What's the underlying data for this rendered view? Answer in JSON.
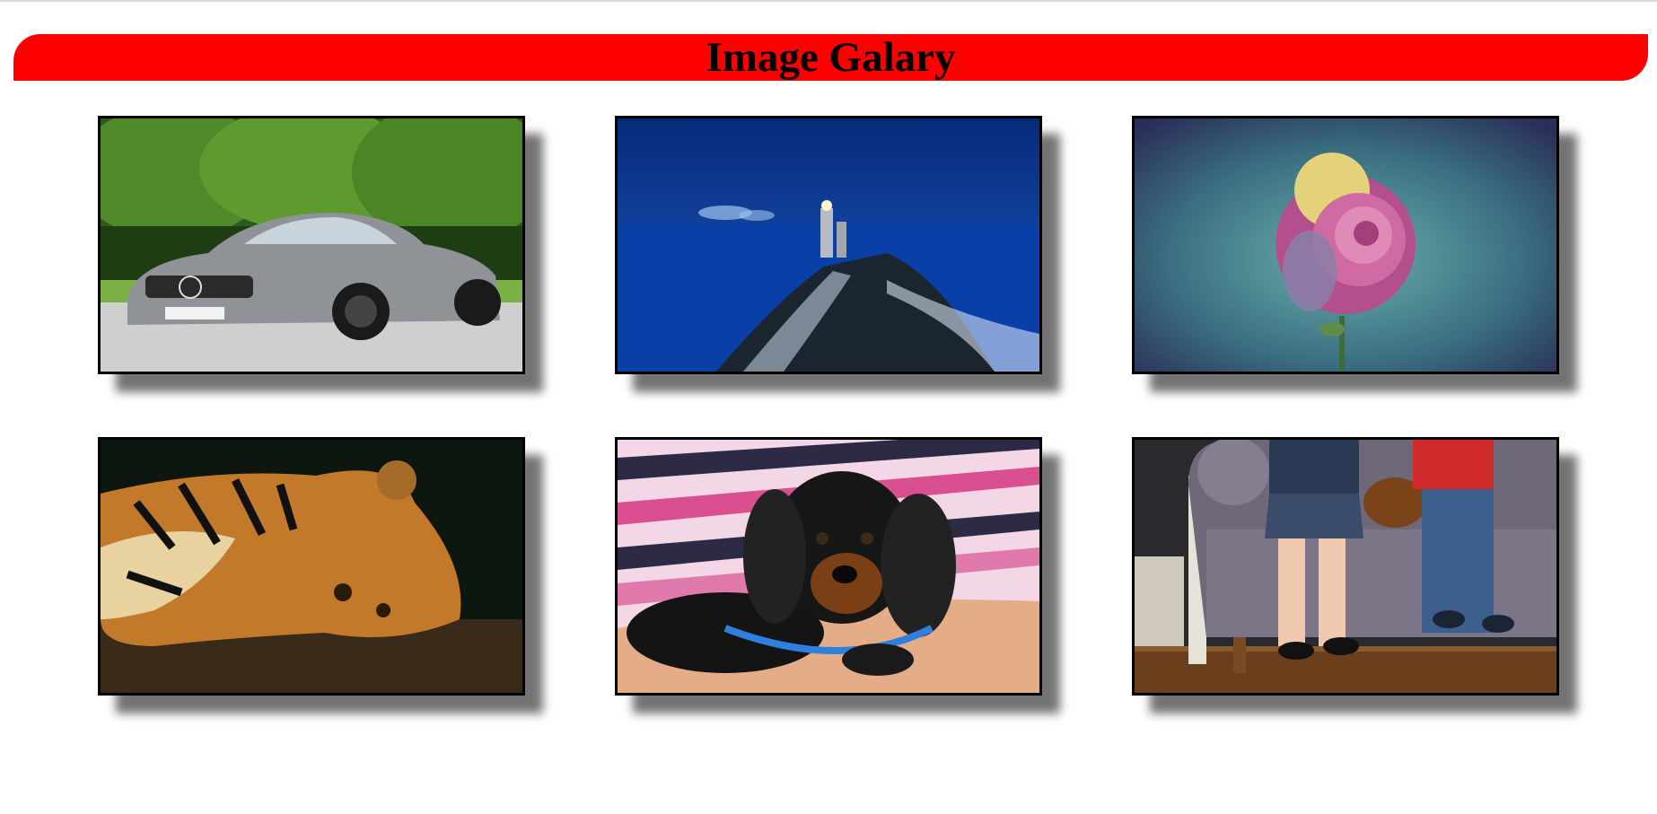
{
  "header": {
    "title": "Image Galary"
  },
  "gallery": {
    "images": [
      {
        "subject": "silver-sports-car"
      },
      {
        "subject": "lighthouse-at-night"
      },
      {
        "subject": "pink-rose"
      },
      {
        "subject": "resting-tiger"
      },
      {
        "subject": "dachshund-puppy"
      },
      {
        "subject": "kids-on-sofa-with-dog"
      }
    ]
  },
  "colors": {
    "banner": "#ff0000",
    "border": "#000000",
    "background": "#ffffff"
  }
}
